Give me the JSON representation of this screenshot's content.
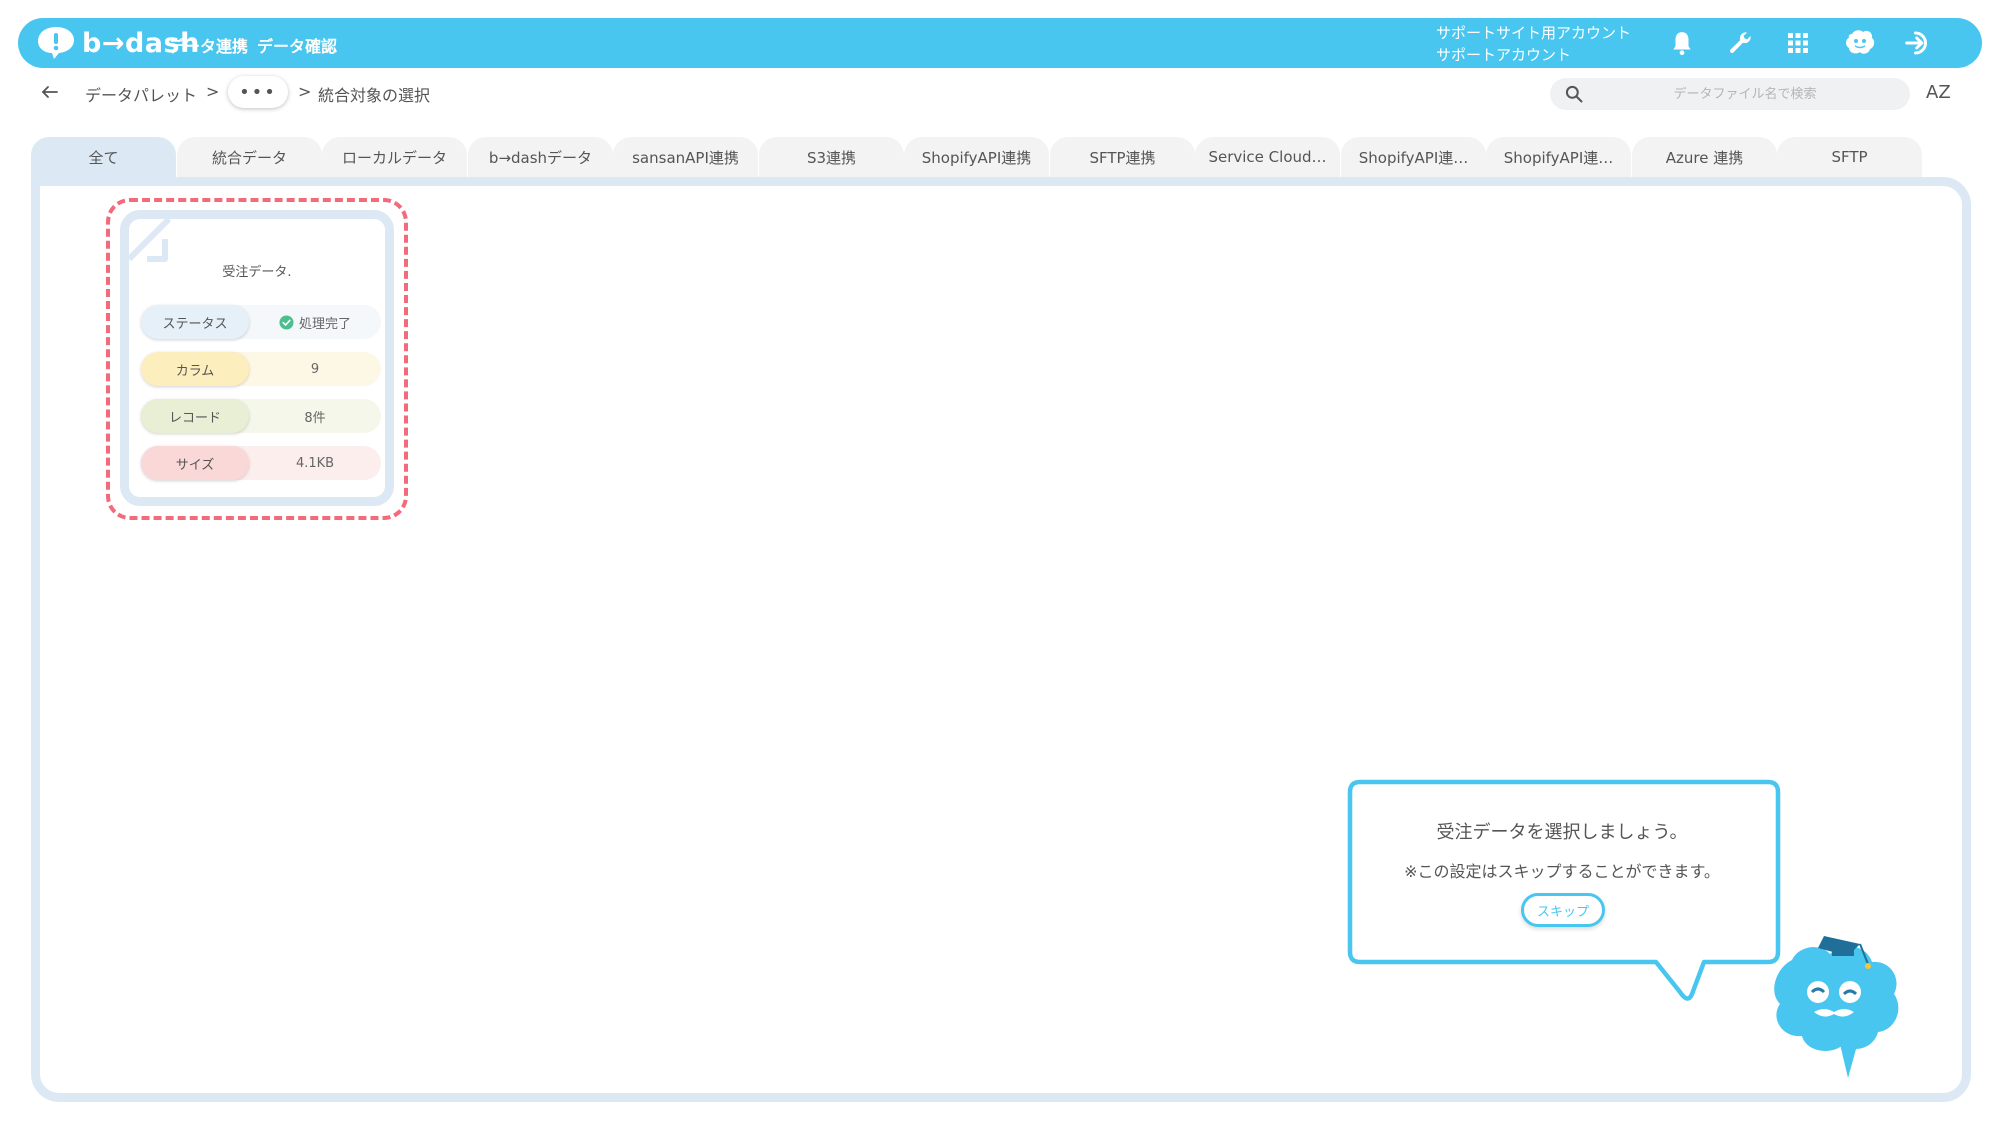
{
  "brand": {
    "logo_text": "b→dash",
    "accent": "#48c6ef",
    "frame_color": "#dce9f4",
    "highlight": "#f26b7a"
  },
  "nav": {
    "links": [
      "データ連携",
      "データ確認"
    ]
  },
  "account": {
    "line1": "サポートサイト用アカウント",
    "line2": "サポートアカウント"
  },
  "top_icons": [
    "bell-icon",
    "wrench-icon",
    "grid-icon",
    "mascot-head-icon",
    "logout-icon"
  ],
  "breadcrumb": {
    "items": [
      "データパレット",
      "統合対象の選択"
    ],
    "more": "•••",
    "separator": ">"
  },
  "search": {
    "placeholder": "データファイル名で検索"
  },
  "sort": {
    "label": "AZ"
  },
  "tabs": [
    {
      "label": "全て",
      "active": true
    },
    {
      "label": "統合データ"
    },
    {
      "label": "ローカルデータ"
    },
    {
      "label": "b→dashデータ"
    },
    {
      "label": "sansanAPI連携"
    },
    {
      "label": "S3連携"
    },
    {
      "label": "ShopifyAPI連携"
    },
    {
      "label": "SFTP連携"
    },
    {
      "label": "Service Cloud…"
    },
    {
      "label": "ShopifyAPI連…"
    },
    {
      "label": "ShopifyAPI連…"
    },
    {
      "label": "Azure 連携"
    },
    {
      "label": "SFTP"
    }
  ],
  "card": {
    "title": "受注データ.",
    "rows": [
      {
        "label": "ステータス",
        "value": "処理完了",
        "label_bg": "#e6f0f8",
        "value_bg": "#f4f8fb",
        "status_color": "#4cbf8f"
      },
      {
        "label": "カラム",
        "value": "9",
        "label_bg": "#fdeebe",
        "value_bg": "#fdf8e6"
      },
      {
        "label": "レコード",
        "value": "8件",
        "label_bg": "#e8efd4",
        "value_bg": "#f4f7ea"
      },
      {
        "label": "サイズ",
        "value": "4.1KB",
        "label_bg": "#fbd8d8",
        "value_bg": "#fdeeee"
      }
    ]
  },
  "tooltip": {
    "title": "受注データを選択しましょう。",
    "note": "※この設定はスキップすることができます。",
    "skip_label": "スキップ"
  }
}
